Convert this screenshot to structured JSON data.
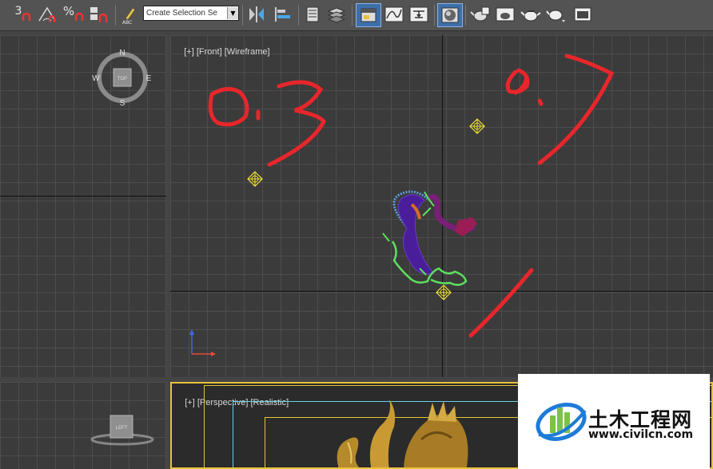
{
  "toolbar": {
    "snap_3d_label": "3",
    "percent_label": "%",
    "selection_set": {
      "value": "Create Selection Se",
      "placeholder": "Create Selection Set"
    },
    "abc_label": "ABC"
  },
  "front_viewport": {
    "label_plus": "[+]",
    "label_view": "[Front]",
    "label_mode": "[Wireframe]",
    "viewcube": {
      "north": "N",
      "south": "S",
      "east": "E",
      "west": "W",
      "face": "TOP"
    },
    "annotations": {
      "left": "0.3",
      "right": "0.7"
    }
  },
  "perspective_viewport": {
    "label_plus": "[+]",
    "label_view": "[Perspective]",
    "label_mode": "[Realistic]"
  },
  "left_viewport": {
    "viewcube_face": "LEFT"
  },
  "watermark": {
    "text_cn": "土木工程网",
    "url": "www.civilcn.com"
  },
  "colors": {
    "viewport_bg": "#3b3b3b",
    "grid": "#4d4d4d",
    "axis": "#121212",
    "annotation_red": "#e8262b",
    "light_yellow": "#f2e23a",
    "active_border": "#e8c23a"
  }
}
